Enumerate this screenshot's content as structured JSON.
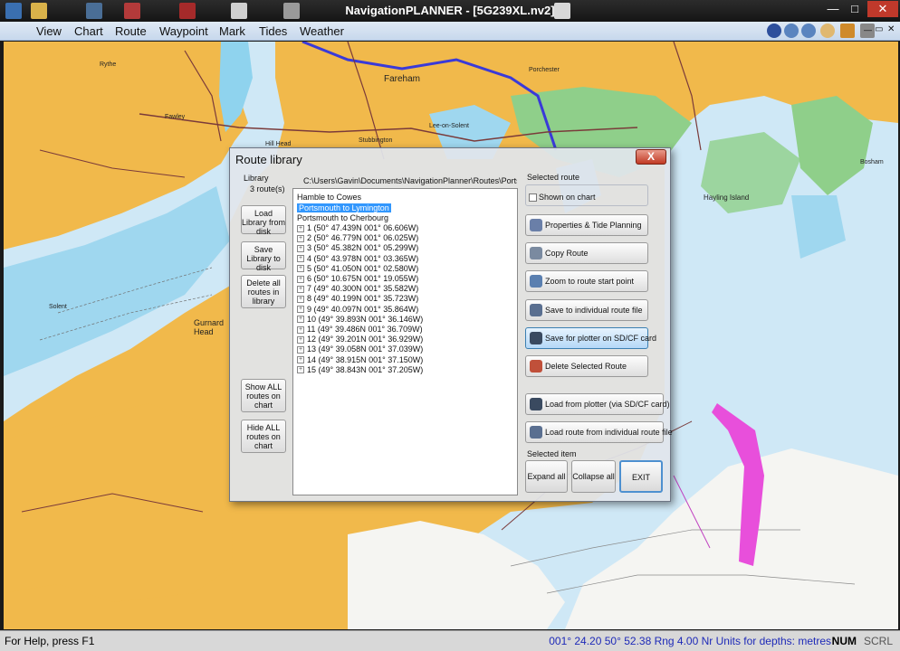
{
  "window": {
    "title": "NavigationPLANNER - [5G239XL.nv2]"
  },
  "menu": [
    "View",
    "Chart",
    "Route",
    "Waypoint",
    "Mark",
    "Tides",
    "Weather"
  ],
  "map_labels": [
    "Fareham",
    "Gurnard Head",
    "Hayling Island",
    "Rythe",
    "Fawley",
    "Solent",
    "Hill Head",
    "Lee-on-Solent",
    "Stubbington",
    "Porchester",
    "Bosham"
  ],
  "dialog": {
    "title": "Route library",
    "close_label": "X",
    "library_label": "Library",
    "route_count": "3 route(s)",
    "path": "C:\\Users\\Gavin\\Documents\\NavigationPlanner\\Routes\\Portsmouth",
    "left_buttons": [
      {
        "label": "Load Library from disk"
      },
      {
        "label": "Save Library to disk"
      },
      {
        "label": "Delete all routes in library"
      },
      {
        "label": "Show ALL routes on chart"
      },
      {
        "label": "Hide ALL routes on chart"
      }
    ],
    "routes": [
      "Hamble to Cowes",
      "Portsmouth to Lymington",
      "Portsmouth to Cherbourg"
    ],
    "selected_route_index": 1,
    "waypoints": [
      "1 (50° 47.439N  001° 06.606W)",
      "2 (50° 46.779N  001° 06.025W)",
      "3 (50° 45.382N  001° 05.299W)",
      "4 (50° 43.978N  001° 03.365W)",
      "5 (50° 41.050N  001° 02.580W)",
      "6 (50° 10.675N  001° 19.055W)",
      "7 (49° 40.300N  001° 35.582W)",
      "8 (49° 40.199N  001° 35.723W)",
      "9 (49° 40.097N  001° 35.864W)",
      "10 (49° 39.893N  001° 36.146W)",
      "11 (49° 39.486N  001° 36.709W)",
      "12 (49° 39.201N  001° 36.929W)",
      "13 (49° 39.058N  001° 37.039W)",
      "14 (49° 38.915N  001° 37.150W)",
      "15 (49° 38.843N  001° 37.205W)"
    ],
    "selected_route_label": "Selected route",
    "shown_on_chart_label": "Shown on chart",
    "shown_on_chart_checked": false,
    "route_buttons": [
      "Properties & Tide Planning",
      "Copy Route",
      "Zoom to route start point",
      "Save to individual route file",
      "Save for plotter on SD/CF card",
      "Delete Selected Route"
    ],
    "load_buttons": [
      "Load from plotter (via SD/CF card)",
      "Load route from individual route file"
    ],
    "selected_item_label": "Selected item",
    "expand_label": "Expand all",
    "collapse_label": "Collapse all",
    "exit_label": "EXIT"
  },
  "status": {
    "help": "For Help, press F1",
    "coords": "001° 24.20 50° 52.38 Rng 4.00 Nr Units for depths: metres",
    "num": "NUM",
    "scrl": "SCRL"
  }
}
